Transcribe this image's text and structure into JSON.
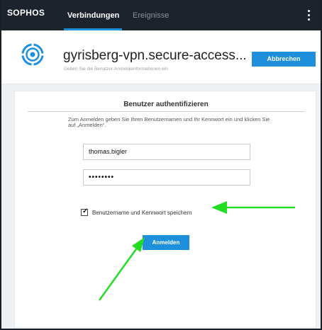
{
  "topbar": {
    "brand": "SOPHOS",
    "tabs": [
      {
        "label": "Verbindungen",
        "active": true
      },
      {
        "label": "Ereignisse",
        "active": false
      }
    ]
  },
  "header": {
    "title": "gyrisberg-vpn.secure-access...",
    "subtitle": "Geben Sie die Benutzer-Anmeldeinformationen ein",
    "cancel_label": "Abbrechen"
  },
  "auth": {
    "title": "Benutzer authentifizieren",
    "instructions": "Zum Anmelden geben Sie Ihren Benutzernamen und Ihr Kennwort ein und klicken Sie auf „Anmelden“.",
    "username_value": "thomas.bigler",
    "password_value": "••••••••",
    "remember_checked": true,
    "remember_label": "Benutzername und Kennwort speichern",
    "login_label": "Anmelden"
  },
  "colors": {
    "accent": "#1d8fdb",
    "topbar": "#1d232d",
    "annotation_arrow": "#22dd22"
  },
  "icons": {
    "menu": "kebab-menu-icon",
    "connection": "vpn-connection-icon",
    "check": "checkmark-icon"
  }
}
